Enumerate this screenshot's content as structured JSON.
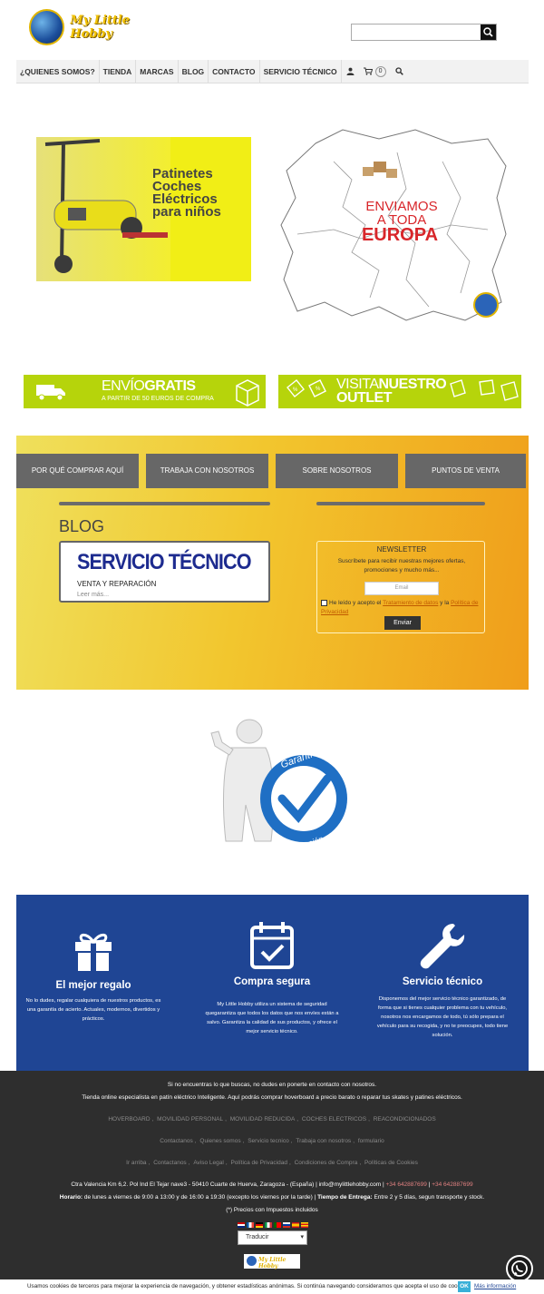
{
  "header": {
    "logo_text": "My Little Hobby",
    "search": {
      "placeholder": ""
    }
  },
  "nav": {
    "items": [
      "¿QUIENES SOMOS?",
      "TIENDA",
      "MARCAS",
      "BLOG",
      "CONTACTO",
      "SERVICIO TÉCNICO"
    ],
    "cart_count": "0"
  },
  "banners": {
    "scooter_lines": [
      "Patinetes",
      "Coches",
      "Eléctricos",
      "para niños"
    ],
    "europe_line1": "ENVIAMOS",
    "europe_line2": "A TODA",
    "europe_line3": "EUROPA",
    "promo1_big_light": "ENVÍO",
    "promo1_big_bold": "GRATIS",
    "promo1_small": "A PARTIR DE 50 EUROS DE COMPRA",
    "promo2_line1_light": "VISITA",
    "promo2_line1_bold": "NUESTRO",
    "promo2_line2": "OUTLET"
  },
  "tabs": [
    "POR QUÉ COMPRAR AQUÍ",
    "TRABAJA CON NOSOTROS",
    "SOBRE NOSOTROS",
    "PUNTOS DE VENTA"
  ],
  "blog": {
    "title": "BLOG",
    "card_title": "SERVICIO TÉCNICO",
    "card_sub": "VENTA Y REPARACIÓN",
    "read_more": "Leer más..."
  },
  "newsletter": {
    "title": "NEWSLETTER",
    "desc": "Suscríbete para recibir nuestras mejores ofertas, promociones y mucho más...",
    "email_placeholder": "Email",
    "agree_pre": "He leído y acepto el",
    "agree_link1": "Tratamiento de datos",
    "agree_mid": "y la",
    "agree_link2": "Política de Privacidad",
    "send": "Enviar"
  },
  "guarantee": {
    "line1": "Garantía",
    "line2": "de Satisfacción"
  },
  "features": [
    {
      "title": "El mejor regalo",
      "icon": "gift-icon",
      "desc": "No lo dudes, regalar cualquiera de nuestros productos, es una garantía de acierto. Actuales, modernos, divertidos y prácticos."
    },
    {
      "title": "Compra segura",
      "icon": "calendar-check-icon",
      "desc": "My Little Hobby utiliza un sistema de seguridad quegarantiza que todos los datos que nos envíes están a salvo. Garantiza la calidad de sus productos, y ofrece el mejor servicio técnico."
    },
    {
      "title": "Servicio técnico",
      "icon": "wrench-icon",
      "desc": "Disponemos del mejor servicio técnico garantizado, de forma que si tienes cualquier problema con tu vehículo, nosotros nos encargamos de todo, tú sólo prepara el vehículo para su recogida, y no te preocupes, todo tiene solución."
    }
  ],
  "footer": {
    "intro1": "Si no encuentras lo que buscas, no dudes en ponerte en contacto con nosotros.",
    "intro2": "Tienda online especialista en patín eléctrico Inteligente. Aquí podrás comprar hoverboard a precio barato o reparar tus skates y patines eléctricos.",
    "categories": [
      "HOVERBOARD",
      "MOVILIDAD PERSONAL",
      "MOVILIDAD REDUCIDA",
      "COCHES ELECTRICOS",
      "REACONDICIONADOS"
    ],
    "links1": [
      "Contactanos",
      "Quienes somos",
      "Servicio tecnico",
      "Trabaja con nosotros",
      "formulario"
    ],
    "links2": [
      "Ir arriba",
      "Contactanos",
      "Aviso Legal",
      "Política de Privacidad",
      "Condiciones de Compra",
      "Políticas de Cookies"
    ],
    "address": "Ctra Valencia Km 6,2. Pol Ind El Tejar nave3 - 50410 Cuarte de Huerva, Zaragoza - (España) | info@mylittlehobby.com |",
    "phone1": "+34 642887699",
    "phone_sep": "|",
    "phone2": "+34 642887699",
    "hours_label": "Horario:",
    "hours": "de lunes a viernes de 9:00 a 13:00 y de 16:00 a 19:30 (excepto los viernes por la tarde) |",
    "delivery_label": "Tiempo de Entrega:",
    "delivery": "Entre 2 y 5 días, segun transporte y stock.",
    "taxes": "(*) Precios con Impuestos incluidos",
    "translate": "Traducir"
  },
  "cookie": {
    "text": "Usamos cookies de terceros para mejorar la experiencia de navegación, y obtener estadísticas anónimas. Si continúa navegando consideramos que acepta el uso de cookies.",
    "ok": "OK",
    "more": "Más información"
  },
  "colors": {
    "nav_bg": "#f2f2f2",
    "promo_green": "#b6d40b",
    "tab_gray": "#676767",
    "feature_blue": "#1f4594",
    "footer_bg": "#2e2e2e",
    "cookie_ok": "#39b0d8"
  }
}
